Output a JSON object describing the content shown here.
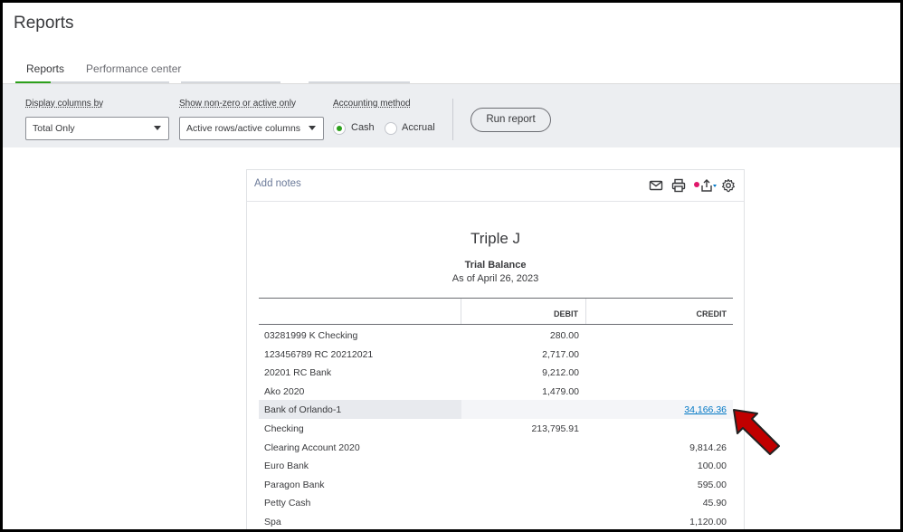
{
  "page": {
    "title": "Reports"
  },
  "tabs": [
    {
      "label": "Reports",
      "active": true
    },
    {
      "label": "Performance center",
      "active": false
    }
  ],
  "filters": {
    "display_columns": {
      "label": "Display columns by",
      "value": "Total Only"
    },
    "non_zero": {
      "label": "Show non-zero or active only",
      "value": "Active rows/active columns"
    },
    "accounting_method": {
      "label": "Accounting method",
      "options": [
        {
          "label": "Cash",
          "checked": true
        },
        {
          "label": "Accrual",
          "checked": false
        }
      ]
    },
    "run_report_label": "Run report"
  },
  "report": {
    "add_notes": "Add notes",
    "toolbar_icons": [
      "email-icon",
      "print-icon",
      "export-icon",
      "settings-icon"
    ],
    "company": "Triple J",
    "name": "Trial Balance",
    "date": "As of April 26, 2023",
    "columns": {
      "debit": "DEBIT",
      "credit": "CREDIT"
    },
    "rows": [
      {
        "name": "03281999 K Checking",
        "debit": "280.00",
        "credit": ""
      },
      {
        "name": "123456789 RC 20212021",
        "debit": "2,717.00",
        "credit": ""
      },
      {
        "name": "20201 RC Bank",
        "debit": "9,212.00",
        "credit": ""
      },
      {
        "name": "Ako 2020",
        "debit": "1,479.00",
        "credit": ""
      },
      {
        "name": "Bank of Orlando-1",
        "debit": "",
        "credit": "34,166.36",
        "highlighted": true,
        "credit_link": true
      },
      {
        "name": "Checking",
        "debit": "213,795.91",
        "credit": ""
      },
      {
        "name": "Clearing Account 2020",
        "debit": "",
        "credit": "9,814.26"
      },
      {
        "name": "Euro Bank",
        "debit": "",
        "credit": "100.00"
      },
      {
        "name": "Paragon Bank",
        "debit": "",
        "credit": "595.00"
      },
      {
        "name": "Petty Cash",
        "debit": "",
        "credit": "45.90"
      },
      {
        "name": "Spa",
        "debit": "",
        "credit": "1,120.00"
      }
    ]
  },
  "colors": {
    "accent": "#2ca01c",
    "link": "#0077c5",
    "annotation_arrow": "#c00000",
    "notification_dot": "#e0176a"
  }
}
